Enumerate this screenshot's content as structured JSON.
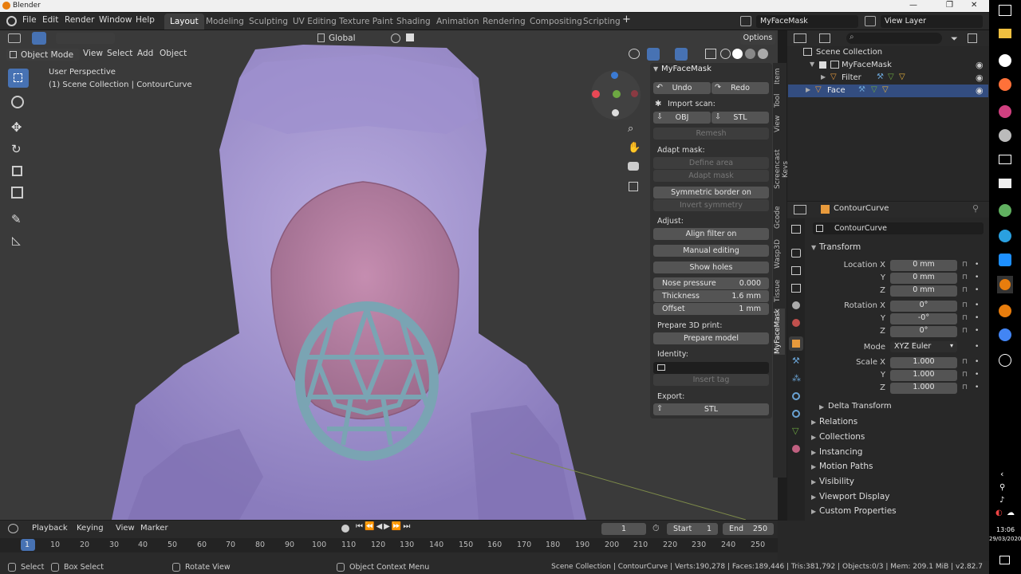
{
  "window": {
    "app_title": "Blender",
    "minimize": "—",
    "maximize": "❐",
    "close": "✕"
  },
  "menu": [
    "File",
    "Edit",
    "Render",
    "Window",
    "Help"
  ],
  "workspaces": [
    "Layout",
    "Modeling",
    "Sculpting",
    "UV Editing",
    "Texture Paint",
    "Shading",
    "Animation",
    "Rendering",
    "Compositing",
    "Scripting"
  ],
  "workspace_add": "+",
  "scene": {
    "name": "MyFaceMask",
    "view_layer": "View Layer"
  },
  "viewport": {
    "transform_orientation": "Global",
    "options_label": "Options",
    "mode": "Object Mode",
    "header_menu": [
      "View",
      "Select",
      "Add",
      "Object"
    ],
    "perspective": "User Perspective",
    "collection_info": "(1) Scene Collection | ContourCurve"
  },
  "npanel": {
    "title": "MyFaceMask",
    "undo": "Undo",
    "redo": "Redo",
    "import_scan": "Import scan:",
    "obj": "OBJ",
    "stl": "STL",
    "remesh": "Remesh",
    "adapt_mask": "Adapt mask:",
    "define_area": "Define area",
    "adapt_mask_btn": "Adapt mask",
    "symmetric_border": "Symmetric border on",
    "invert_symmetry": "Invert symmetry",
    "adjust": "Adjust:",
    "align_filter": "Align filter on",
    "manual_editing": "Manual editing",
    "show_holes": "Show holes",
    "nose_pressure_label": "Nose pressure",
    "nose_pressure_value": "0.000",
    "thickness_label": "Thickness",
    "thickness_value": "1.6 mm",
    "offset_label": "Offset",
    "offset_value": "1 mm",
    "prepare_3d": "Prepare 3D print:",
    "prepare_model": "Prepare model",
    "identity": "Identity:",
    "insert_tag": "Insert tag",
    "export": "Export:",
    "export_stl": "STL"
  },
  "vtabs": [
    "Item",
    "Tool",
    "View",
    "Screencast Keys",
    "Gcode",
    "Wasp3D",
    "Tissue",
    "MyFaceMask"
  ],
  "outliner": {
    "scene_collection": "Scene Collection",
    "items": [
      "MyFaceMask",
      "Filter",
      "Face"
    ]
  },
  "properties": {
    "object_name": "ContourCurve",
    "object_field": "ContourCurve",
    "transform": "Transform",
    "location_x_label": "Location X",
    "location_x": "0 mm",
    "location_y": "0 mm",
    "location_z": "0 mm",
    "rotation_x_label": "Rotation X",
    "rotation_x": "0°",
    "rotation_y": "-0°",
    "rotation_z": "0°",
    "mode_label": "Mode",
    "mode_value": "XYZ Euler",
    "scale_x_label": "Scale X",
    "scale_x": "1.000",
    "scale_y": "1.000",
    "scale_z": "1.000",
    "y_label": "Y",
    "z_label": "Z",
    "delta": "Delta Transform",
    "sections": [
      "Relations",
      "Collections",
      "Instancing",
      "Motion Paths",
      "Visibility",
      "Viewport Display",
      "Custom Properties"
    ]
  },
  "timeline": {
    "menus": [
      "Playback",
      "Keying",
      "View",
      "Marker"
    ],
    "current_frame": "1",
    "start_label": "Start",
    "start": "1",
    "end_label": "End",
    "end": "250",
    "ticks": [
      "1",
      "10",
      "20",
      "30",
      "40",
      "50",
      "60",
      "70",
      "80",
      "90",
      "100",
      "110",
      "120",
      "130",
      "140",
      "150",
      "160",
      "170",
      "180",
      "190",
      "200",
      "210",
      "220",
      "230",
      "240",
      "250"
    ]
  },
  "status": {
    "select": "Select",
    "box_select": "Box Select",
    "rotate_view": "Rotate View",
    "context_menu": "Object Context Menu",
    "stats": "Scene Collection | ContourCurve | Verts:190,278 | Faces:189,446 | Tris:381,792 | Objects:0/3 | Mem: 209.1 MiB | v2.82.7"
  },
  "clock": {
    "time": "13:06",
    "date": "29/03/2020"
  },
  "colors": {
    "accent": "#4772b3",
    "mesh": "#a99bd4",
    "mask": "#b77ea3",
    "filter": "#7aa4b3",
    "red_axis": "#e84855",
    "green_axis": "#6da842",
    "blue_axis": "#3b7bd4"
  }
}
